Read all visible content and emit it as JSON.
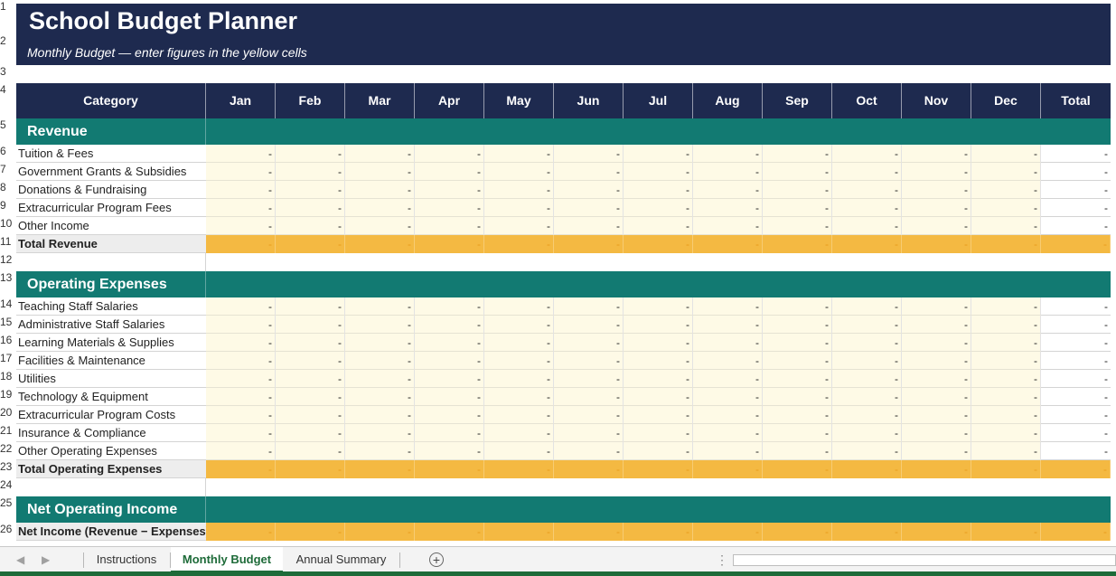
{
  "title": "School Budget Planner",
  "subtitle": "Monthly Budget — enter figures in the yellow cells",
  "header": {
    "category": "Category",
    "months": [
      "Jan",
      "Feb",
      "Mar",
      "Apr",
      "May",
      "Jun",
      "Jul",
      "Aug",
      "Sep",
      "Oct",
      "Nov",
      "Dec"
    ],
    "total": "Total"
  },
  "row_numbers": [
    "1",
    "2",
    "3",
    "4",
    "5",
    "6",
    "7",
    "8",
    "9",
    "10",
    "11",
    "12",
    "13",
    "14",
    "15",
    "16",
    "17",
    "18",
    "19",
    "20",
    "21",
    "22",
    "23",
    "24",
    "25",
    "26"
  ],
  "empty_value": "-",
  "sections": {
    "revenue": {
      "label": "Revenue",
      "items": [
        "Tuition & Fees",
        "Government Grants & Subsidies",
        "Donations & Fundraising",
        "Extracurricular Program Fees",
        "Other Income"
      ],
      "total_label": "Total Revenue"
    },
    "expenses": {
      "label": "Operating Expenses",
      "items": [
        "Teaching Staff Salaries",
        "Administrative Staff Salaries",
        "Learning Materials & Supplies",
        "Facilities & Maintenance",
        "Utilities",
        "Technology & Equipment",
        "Extracurricular Program Costs",
        "Insurance & Compliance",
        "Other Operating Expenses"
      ],
      "total_label": "Total Operating Expenses"
    },
    "net": {
      "label": "Net Operating Income",
      "net_label": "Net Income (Revenue − Expenses)"
    }
  },
  "tabs": {
    "instructions": "Instructions",
    "monthly": "Monthly Budget",
    "annual": "Annual Summary",
    "active": "monthly"
  },
  "colors": {
    "navy": "#1e2a4f",
    "teal": "#127a72",
    "yellow_input": "#fefae6",
    "orange_total": "#f4b942",
    "excel_green": "#1e6b39"
  }
}
